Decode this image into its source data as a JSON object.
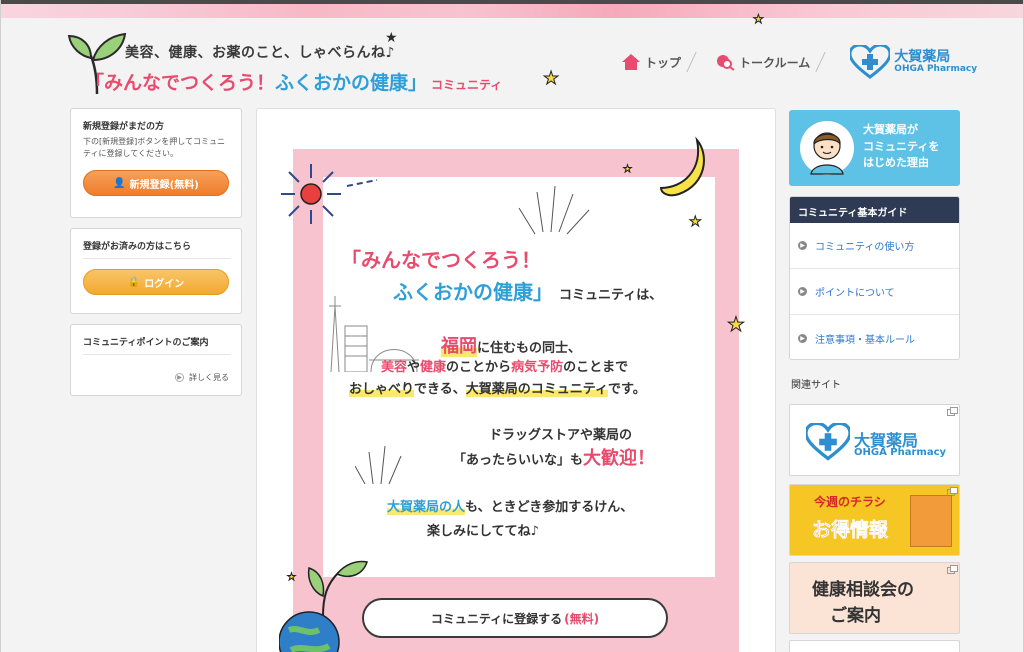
{
  "header": {
    "tagline": "美容、健康、お薬のこと、しゃべらんね♪",
    "title_part1": "「みんなでつくろう！",
    "title_part2": "ふくおかの健康」",
    "title_part3": "コミュニティ"
  },
  "nav": {
    "items": [
      {
        "label": "トップ",
        "icon": "home-icon"
      },
      {
        "label": "トークルーム",
        "icon": "chat-search-icon"
      }
    ],
    "brand_jp": "大賀薬局",
    "brand_en": "OHGA Pharmacy"
  },
  "left": {
    "register_box": {
      "title": "新規登録がまだの方",
      "desc": "下の[新規登録]ボタンを押してコミュニティに登録してください。",
      "button": "新規登録(無料)"
    },
    "login_box": {
      "title": "登録がお済みの方はこちら",
      "button": "ログイン"
    },
    "points_box": {
      "title": "コミュニティポイントのご案内",
      "link": "詳しく見る"
    }
  },
  "poster": {
    "head1": "「みんなでつくろう！",
    "head2": "ふくおかの健康」",
    "head2_tail": "コミュニティは、",
    "line1_a": "福岡",
    "line1_b": "に住むもの同士、",
    "line2_a": "美容",
    "line2_b": "や",
    "line2_c": "健康",
    "line2_d": "のことから",
    "line2_e": "病気予防",
    "line2_f": "のことまで",
    "line3_a": "おしゃべり",
    "line3_b": "できる、",
    "line3_c": "大賀薬局のコミュニティ",
    "line3_d": "です。",
    "line4": "ドラッグストアや薬局の",
    "line5_a": "「あったらいいな」",
    "line5_b": "も",
    "line5_c": "大歓迎！",
    "line6_a": "大賀薬局の人",
    "line6_b": "も、ときどき参加するけん、",
    "line7": "楽しみにしててね♪",
    "register_label": "コミュニティに登録する",
    "register_free": "(無料)"
  },
  "right": {
    "reason_text": "大賀薬局がコミュニティをはじめた理由",
    "reason_lines": [
      "大賀薬局が",
      "コミュニティを",
      "はじめた理由"
    ],
    "guide_title": "コミュニティ基本ガイド",
    "guide_items": [
      "コミュニティの使い方",
      "ポイントについて",
      "注意事項・基本ルール"
    ],
    "related_title": "関連サイト",
    "banner_ohga_jp": "大賀薬局",
    "banner_ohga_en": "OHGA Pharmacy",
    "banner_flyer_1": "今週のチラシ",
    "banner_flyer_2": "お得情報",
    "banner_health_1": "健康相談会の",
    "banner_health_2": "ご案内"
  },
  "colors": {
    "pink": "#e84b6e",
    "blue": "#2e9fd7",
    "poster_bg": "#f7c3cf",
    "guide_head": "#2f3a55",
    "reason_bg": "#5ec2e6",
    "orange_btn": "#ef7d2a",
    "yellow_btn": "#f3a931"
  }
}
